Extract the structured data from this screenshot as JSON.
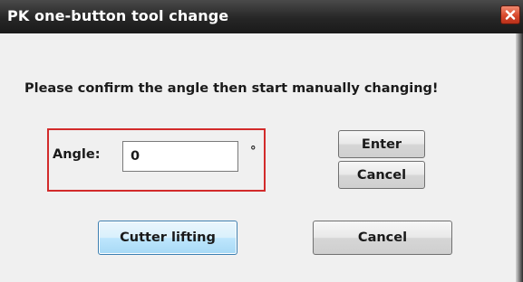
{
  "window": {
    "title": "PK one-button tool change"
  },
  "dialog": {
    "prompt": "Please confirm the angle then start manually changing!",
    "angle_label": "Angle:",
    "angle_value": "0",
    "degree_symbol": "°",
    "enter_label": "Enter",
    "cancel_small_label": "Cancel",
    "cutter_lifting_label": "Cutter lifting",
    "cancel_big_label": "Cancel"
  },
  "colors": {
    "highlight_border": "#d22b2b",
    "close_button": "#d8482c",
    "focused_button": "#bee6fd"
  },
  "icons": {
    "close": "close-icon"
  }
}
